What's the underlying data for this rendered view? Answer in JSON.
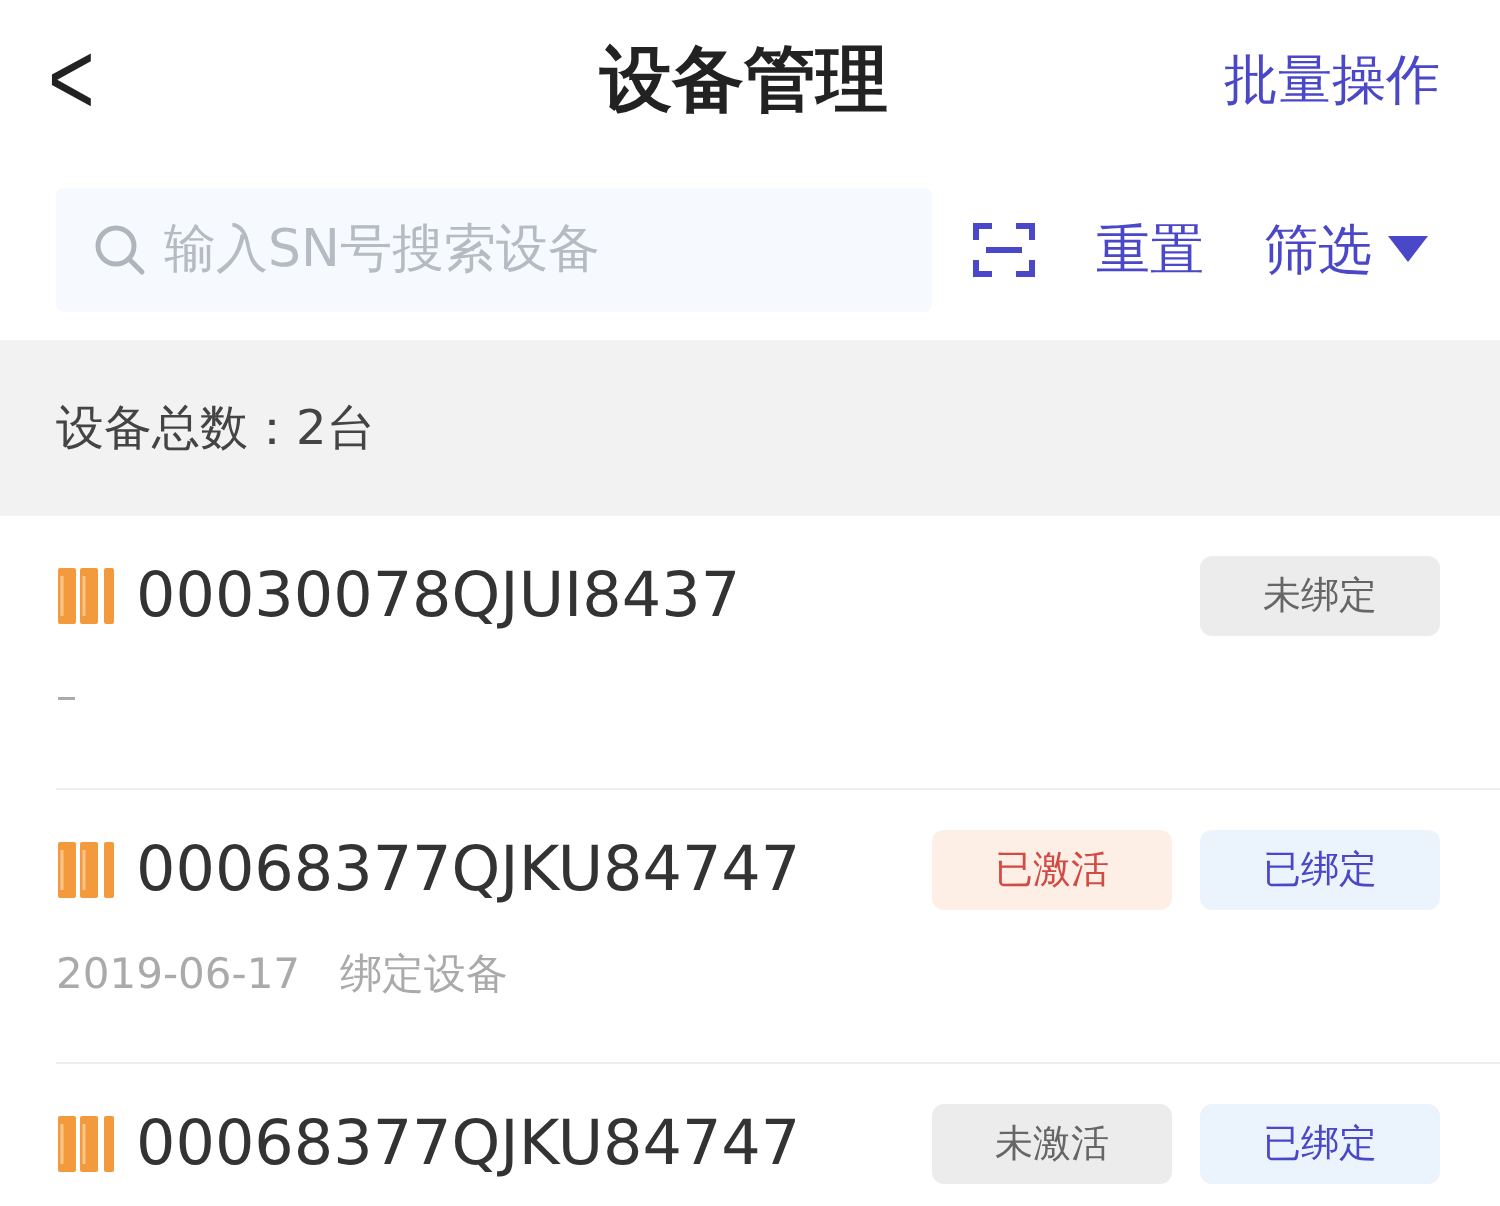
{
  "header": {
    "back": "<",
    "title": "设备管理",
    "action": "批量操作"
  },
  "search": {
    "placeholder": "输入SN号搜索设备",
    "reset": "重置",
    "filter": "筛选"
  },
  "summary": "设备总数：2台",
  "devices": [
    {
      "sn": "00030078QJUI8437",
      "detail": "–",
      "tags": [
        {
          "label": "未绑定",
          "kind": "unbound"
        }
      ]
    },
    {
      "sn": "00068377QJKU84747",
      "detail": "2019-06-17   绑定设备",
      "tags": [
        {
          "label": "已激活",
          "kind": "activated"
        },
        {
          "label": "已绑定",
          "kind": "bound"
        }
      ]
    },
    {
      "sn": "00068377QJKU84747",
      "tags": [
        {
          "label": "未激活",
          "kind": "inactive"
        },
        {
          "label": "已绑定",
          "kind": "bound"
        }
      ]
    }
  ]
}
